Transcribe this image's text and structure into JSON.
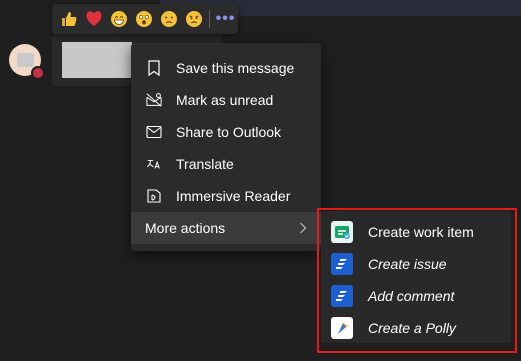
{
  "reactions": [
    {
      "name": "like",
      "color": "#f6c23a"
    },
    {
      "name": "heart",
      "color": "#e2303d"
    },
    {
      "name": "laugh",
      "color": "#f6c23a"
    },
    {
      "name": "surprised",
      "color": "#f6c23a"
    },
    {
      "name": "sad",
      "color": "#f6c23a"
    },
    {
      "name": "angry",
      "color": "#f6c23a"
    }
  ],
  "reaction_more_label": "•••",
  "menu": {
    "items": [
      {
        "label": "Save this message",
        "icon": "bookmark-icon"
      },
      {
        "label": "Mark as unread",
        "icon": "unread-icon"
      },
      {
        "label": "Share to Outlook",
        "icon": "mail-icon"
      },
      {
        "label": "Translate",
        "icon": "translate-icon"
      },
      {
        "label": "Immersive Reader",
        "icon": "immersive-reader-icon"
      },
      {
        "label": "More actions",
        "icon": "chevron-right-icon"
      }
    ]
  },
  "submenu": {
    "items": [
      {
        "label": "Create work item",
        "app": "azure-boards"
      },
      {
        "label": "Create issue",
        "app": "jira"
      },
      {
        "label": "Add comment",
        "app": "jira"
      },
      {
        "label": "Create a Polly",
        "app": "polly"
      }
    ]
  },
  "colors": {
    "background": "#1f1f1f",
    "menu": "#2b2b2b",
    "highlight": "#3b3b3b",
    "accent_dots": "#8b8fe6",
    "jira_blue": "#1d5fd1",
    "red_outline": "#e21b1b"
  }
}
